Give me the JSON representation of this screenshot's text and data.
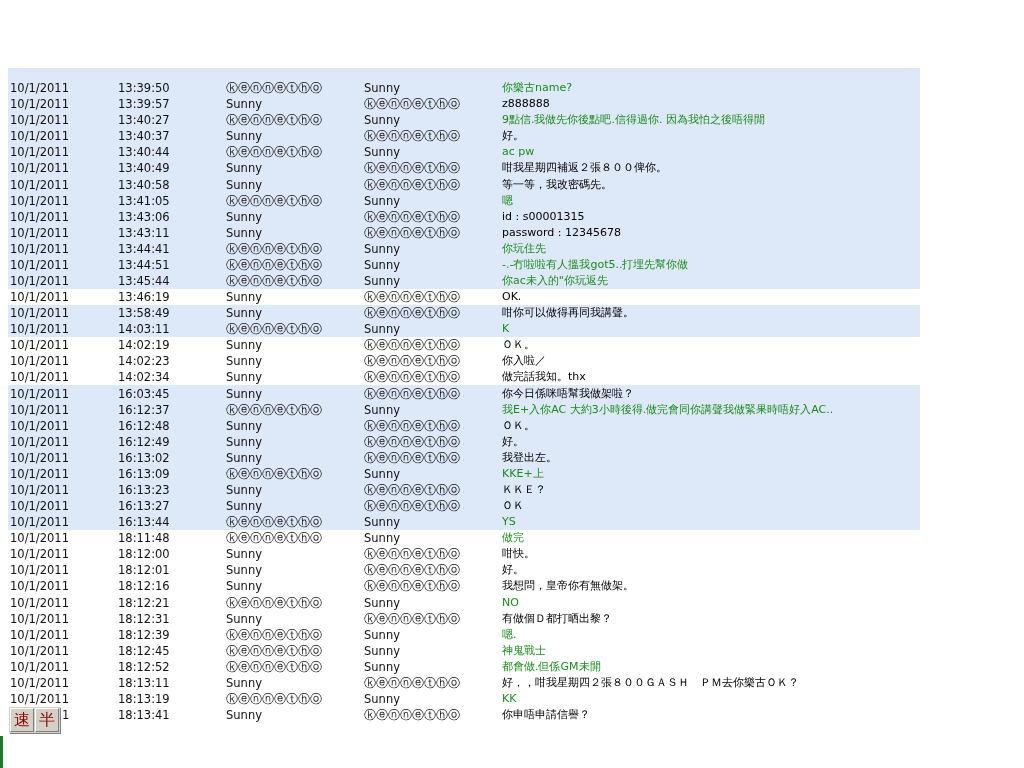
{
  "log": {
    "rows": [
      {
        "date": "10/1/2011",
        "time": "13:39:50",
        "sender": "ⓚⓔⓝⓝⓔⓣⓗⓞ",
        "recipient": "Sunny",
        "message": "你樂古name?",
        "kind": "green",
        "highlighted": true
      },
      {
        "date": "10/1/2011",
        "time": "13:39:57",
        "sender": "Sunny",
        "recipient": "ⓚⓔⓝⓝⓔⓣⓗⓞ",
        "message": "z888888",
        "kind": "plain",
        "highlighted": true
      },
      {
        "date": "10/1/2011",
        "time": "13:40:27",
        "sender": "ⓚⓔⓝⓝⓔⓣⓗⓞ",
        "recipient": "Sunny",
        "message": "9點信.我做先你後點吧.信得過你. 因為我怕之後唔得閒",
        "kind": "green",
        "highlighted": true
      },
      {
        "date": "10/1/2011",
        "time": "13:40:37",
        "sender": "Sunny",
        "recipient": "ⓚⓔⓝⓝⓔⓣⓗⓞ",
        "message": "好。",
        "kind": "plain",
        "highlighted": true
      },
      {
        "date": "10/1/2011",
        "time": "13:40:44",
        "sender": "ⓚⓔⓝⓝⓔⓣⓗⓞ",
        "recipient": "Sunny",
        "message": "ac pw",
        "kind": "green",
        "highlighted": true
      },
      {
        "date": "10/1/2011",
        "time": "13:40:49",
        "sender": "Sunny",
        "recipient": "ⓚⓔⓝⓝⓔⓣⓗⓞ",
        "message": "咁我星期四補返２張８００俾你。",
        "kind": "plain",
        "highlighted": true
      },
      {
        "date": "10/1/2011",
        "time": "13:40:58",
        "sender": "Sunny",
        "recipient": "ⓚⓔⓝⓝⓔⓣⓗⓞ",
        "message": "等一等，我改密碼先。",
        "kind": "plain",
        "highlighted": true
      },
      {
        "date": "10/1/2011",
        "time": "13:41:05",
        "sender": "ⓚⓔⓝⓝⓔⓣⓗⓞ",
        "recipient": "Sunny",
        "message": "嗯",
        "kind": "green",
        "highlighted": true
      },
      {
        "date": "10/1/2011",
        "time": "13:43:06",
        "sender": "Sunny",
        "recipient": "ⓚⓔⓝⓝⓔⓣⓗⓞ",
        "message": "id : s00001315",
        "kind": "plain",
        "highlighted": true
      },
      {
        "date": "10/1/2011",
        "time": "13:43:11",
        "sender": "Sunny",
        "recipient": "ⓚⓔⓝⓝⓔⓣⓗⓞ",
        "message": "password : 12345678",
        "kind": "plain",
        "highlighted": true
      },
      {
        "date": "10/1/2011",
        "time": "13:44:41",
        "sender": "ⓚⓔⓝⓝⓔⓣⓗⓞ",
        "recipient": "Sunny",
        "message": "你玩住先",
        "kind": "green",
        "highlighted": true
      },
      {
        "date": "10/1/2011",
        "time": "13:44:51",
        "sender": "ⓚⓔⓝⓝⓔⓣⓗⓞ",
        "recipient": "Sunny",
        "message": "-.-冇啦啦有人搵我got5..打埋先幫你做",
        "kind": "green",
        "highlighted": true
      },
      {
        "date": "10/1/2011",
        "time": "13:45:44",
        "sender": "ⓚⓔⓝⓝⓔⓣⓗⓞ",
        "recipient": "Sunny",
        "message": "你ac未入的\"你玩返先",
        "kind": "green",
        "highlighted": true
      },
      {
        "date": "10/1/2011",
        "time": "13:46:19",
        "sender": "Sunny",
        "recipient": "ⓚⓔⓝⓝⓔⓣⓗⓞ",
        "message": "OK.",
        "kind": "plain",
        "highlighted": false
      },
      {
        "date": "10/1/2011",
        "time": "13:58:49",
        "sender": "Sunny",
        "recipient": "ⓚⓔⓝⓝⓔⓣⓗⓞ",
        "message": "咁你可以做得再同我講聲。",
        "kind": "plain",
        "highlighted": true
      },
      {
        "date": "10/1/2011",
        "time": "14:03:11",
        "sender": "ⓚⓔⓝⓝⓔⓣⓗⓞ",
        "recipient": "Sunny",
        "message": "K",
        "kind": "green",
        "highlighted": true
      },
      {
        "date": "10/1/2011",
        "time": "14:02:19",
        "sender": "Sunny",
        "recipient": "ⓚⓔⓝⓝⓔⓣⓗⓞ",
        "message": "ＯＫ。",
        "kind": "plain",
        "highlighted": false
      },
      {
        "date": "10/1/2011",
        "time": "14:02:23",
        "sender": "Sunny",
        "recipient": "ⓚⓔⓝⓝⓔⓣⓗⓞ",
        "message": "你入啦／",
        "kind": "plain",
        "highlighted": false
      },
      {
        "date": "10/1/2011",
        "time": "14:02:34",
        "sender": "Sunny",
        "recipient": "ⓚⓔⓝⓝⓔⓣⓗⓞ",
        "message": "做完話我知。thx",
        "kind": "plain",
        "highlighted": false
      },
      {
        "date": "10/1/2011",
        "time": "16:03:45",
        "sender": "Sunny",
        "recipient": "ⓚⓔⓝⓝⓔⓣⓗⓞ",
        "message": "你今日係咪唔幫我做架啦？",
        "kind": "plain",
        "highlighted": true
      },
      {
        "date": "10/1/2011",
        "time": "16:12:37",
        "sender": "ⓚⓔⓝⓝⓔⓣⓗⓞ",
        "recipient": "Sunny",
        "message": "我E+入你AC 大約3小時後得.做完會同你講聲我做緊果時唔好入AC..",
        "kind": "green",
        "highlighted": true
      },
      {
        "date": "10/1/2011",
        "time": "16:12:48",
        "sender": "Sunny",
        "recipient": "ⓚⓔⓝⓝⓔⓣⓗⓞ",
        "message": "ＯＫ。",
        "kind": "plain",
        "highlighted": true
      },
      {
        "date": "10/1/2011",
        "time": "16:12:49",
        "sender": "Sunny",
        "recipient": "ⓚⓔⓝⓝⓔⓣⓗⓞ",
        "message": "好。",
        "kind": "plain",
        "highlighted": true
      },
      {
        "date": "10/1/2011",
        "time": "16:13:02",
        "sender": "Sunny",
        "recipient": "ⓚⓔⓝⓝⓔⓣⓗⓞ",
        "message": "我登出左。",
        "kind": "plain",
        "highlighted": true
      },
      {
        "date": "10/1/2011",
        "time": "16:13:09",
        "sender": "ⓚⓔⓝⓝⓔⓣⓗⓞ",
        "recipient": "Sunny",
        "message": "KKE+上",
        "kind": "green",
        "highlighted": true
      },
      {
        "date": "10/1/2011",
        "time": "16:13:23",
        "sender": "Sunny",
        "recipient": "ⓚⓔⓝⓝⓔⓣⓗⓞ",
        "message": "ＫＫＥ？",
        "kind": "plain",
        "highlighted": true
      },
      {
        "date": "10/1/2011",
        "time": "16:13:27",
        "sender": "Sunny",
        "recipient": "ⓚⓔⓝⓝⓔⓣⓗⓞ",
        "message": "ＯＫ",
        "kind": "plain",
        "highlighted": true
      },
      {
        "date": "10/1/2011",
        "time": "16:13:44",
        "sender": "ⓚⓔⓝⓝⓔⓣⓗⓞ",
        "recipient": "Sunny",
        "message": "YS",
        "kind": "green",
        "highlighted": true
      },
      {
        "date": "10/1/2011",
        "time": "18:11:48",
        "sender": "ⓚⓔⓝⓝⓔⓣⓗⓞ",
        "recipient": "Sunny",
        "message": "做完",
        "kind": "green",
        "highlighted": false
      },
      {
        "date": "10/1/2011",
        "time": "18:12:00",
        "sender": "Sunny",
        "recipient": "ⓚⓔⓝⓝⓔⓣⓗⓞ",
        "message": "咁快。",
        "kind": "plain",
        "highlighted": false
      },
      {
        "date": "10/1/2011",
        "time": "18:12:01",
        "sender": "Sunny",
        "recipient": "ⓚⓔⓝⓝⓔⓣⓗⓞ",
        "message": "好。",
        "kind": "plain",
        "highlighted": false
      },
      {
        "date": "10/1/2011",
        "time": "18:12:16",
        "sender": "Sunny",
        "recipient": "ⓚⓔⓝⓝⓔⓣⓗⓞ",
        "message": "我想問，皇帝你有無做架。",
        "kind": "plain",
        "highlighted": false
      },
      {
        "date": "10/1/2011",
        "time": "18:12:21",
        "sender": "ⓚⓔⓝⓝⓔⓣⓗⓞ",
        "recipient": "Sunny",
        "message": "NO",
        "kind": "green",
        "highlighted": false
      },
      {
        "date": "10/1/2011",
        "time": "18:12:31",
        "sender": "Sunny",
        "recipient": "ⓚⓔⓝⓝⓔⓣⓗⓞ",
        "message": "有做個Ｄ都打晒出黎？",
        "kind": "plain",
        "highlighted": false
      },
      {
        "date": "10/1/2011",
        "time": "18:12:39",
        "sender": "ⓚⓔⓝⓝⓔⓣⓗⓞ",
        "recipient": "Sunny",
        "message": "嗯.",
        "kind": "green",
        "highlighted": false
      },
      {
        "date": "10/1/2011",
        "time": "18:12:45",
        "sender": "ⓚⓔⓝⓝⓔⓣⓗⓞ",
        "recipient": "Sunny",
        "message": "神鬼戰士",
        "kind": "green",
        "highlighted": false
      },
      {
        "date": "10/1/2011",
        "time": "18:12:52",
        "sender": "ⓚⓔⓝⓝⓔⓣⓗⓞ",
        "recipient": "Sunny",
        "message": "都會做.但係GM未開",
        "kind": "green",
        "highlighted": false
      },
      {
        "date": "10/1/2011",
        "time": "18:13:11",
        "sender": "Sunny",
        "recipient": "ⓚⓔⓝⓝⓔⓣⓗⓞ",
        "message": "好，，咁我星期四２張８００ＧＡＳＨ　ＰＭ去你樂古ＯＫ？",
        "kind": "plain",
        "highlighted": false
      },
      {
        "date": "10/1/2011",
        "time": "18:13:19",
        "sender": "ⓚⓔⓝⓝⓔⓣⓗⓞ",
        "recipient": "Sunny",
        "message": "KK",
        "kind": "green",
        "highlighted": false
      },
      {
        "date": "1",
        "time": "18:13:41",
        "sender": "Sunny",
        "recipient": "ⓚⓔⓝⓝⓔⓣⓗⓞ",
        "message": "你申唔申請信譽？",
        "kind": "plain",
        "highlighted": false,
        "covered": true
      }
    ]
  },
  "ime_toolbar": {
    "buttons": [
      "速",
      "半"
    ]
  }
}
